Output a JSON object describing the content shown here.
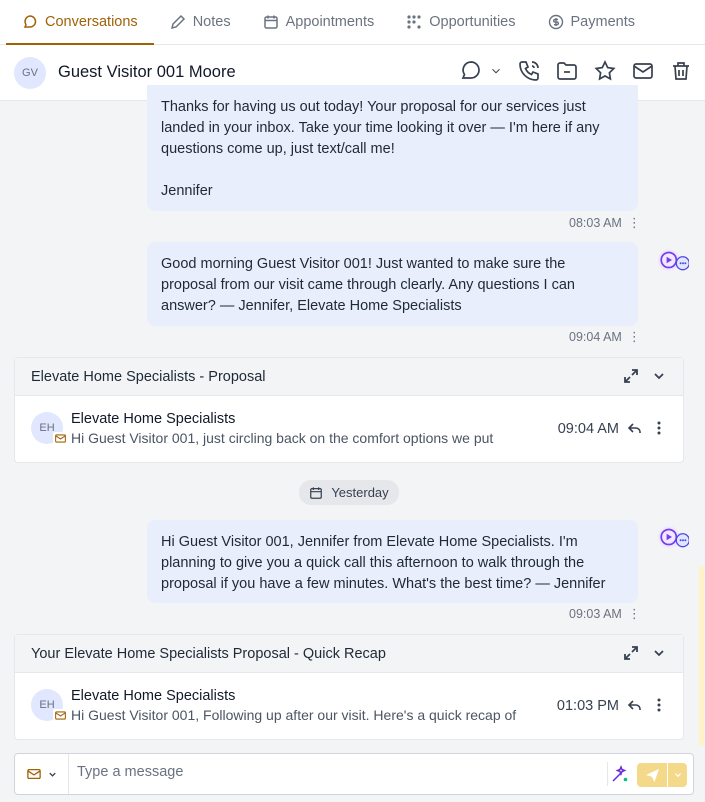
{
  "tabs": [
    {
      "label": "Conversations",
      "icon": "chat-bubble-icon",
      "active": true
    },
    {
      "label": "Notes",
      "icon": "pencil-icon"
    },
    {
      "label": "Appointments",
      "icon": "calendar-icon"
    },
    {
      "label": "Opportunities",
      "icon": "pipeline-icon"
    },
    {
      "label": "Payments",
      "icon": "dollar-icon"
    }
  ],
  "header": {
    "initials": "GV",
    "name": "Guest Visitor 001 Moore",
    "actions": [
      "chat-select-icon",
      "phone-icon",
      "folder-icon",
      "star-icon",
      "mail-icon",
      "trash-icon"
    ]
  },
  "messages": [
    {
      "text": "Thanks for having us out today! Your proposal for our services just landed in your inbox. Take your time looking it over — I'm here if any questions come up, just text/call me!\n\nJennifer",
      "time": "08:03 AM"
    },
    {
      "text": "Good morning Guest Visitor 001! Just wanted to make sure the proposal from our visit came through clearly. Any questions I can answer? — Jennifer, Elevate Home Specialists",
      "time": "09:04 AM"
    },
    {
      "text": "Hi Guest Visitor 001, Jennifer from Elevate Home Specialists. I'm planning to give you a quick call this afternoon to walk through the proposal if you have a few minutes. What's the best time? — Jennifer",
      "time": "09:03 AM"
    }
  ],
  "emails": [
    {
      "subject": "Elevate Home Specialists - Proposal",
      "initials": "EH",
      "sender": "Elevate Home Specialists",
      "snippet": "Hi Guest Visitor 001, just circling back on the comfort options we put",
      "time": "09:04 AM"
    },
    {
      "subject": "Your Elevate Home Specialists Proposal - Quick Recap",
      "initials": "EH",
      "sender": "Elevate Home Specialists",
      "snippet": "Hi Guest Visitor 001, Following up after our visit. Here's a quick recap of",
      "time": "01:03 PM"
    }
  ],
  "date_divider": "Yesterday",
  "composer": {
    "placeholder": "Type a message",
    "channel_icon": "mail-icon"
  },
  "colors": {
    "accent": "#a16207",
    "bubble": "#e8eefb",
    "send": "#f5d98a"
  }
}
